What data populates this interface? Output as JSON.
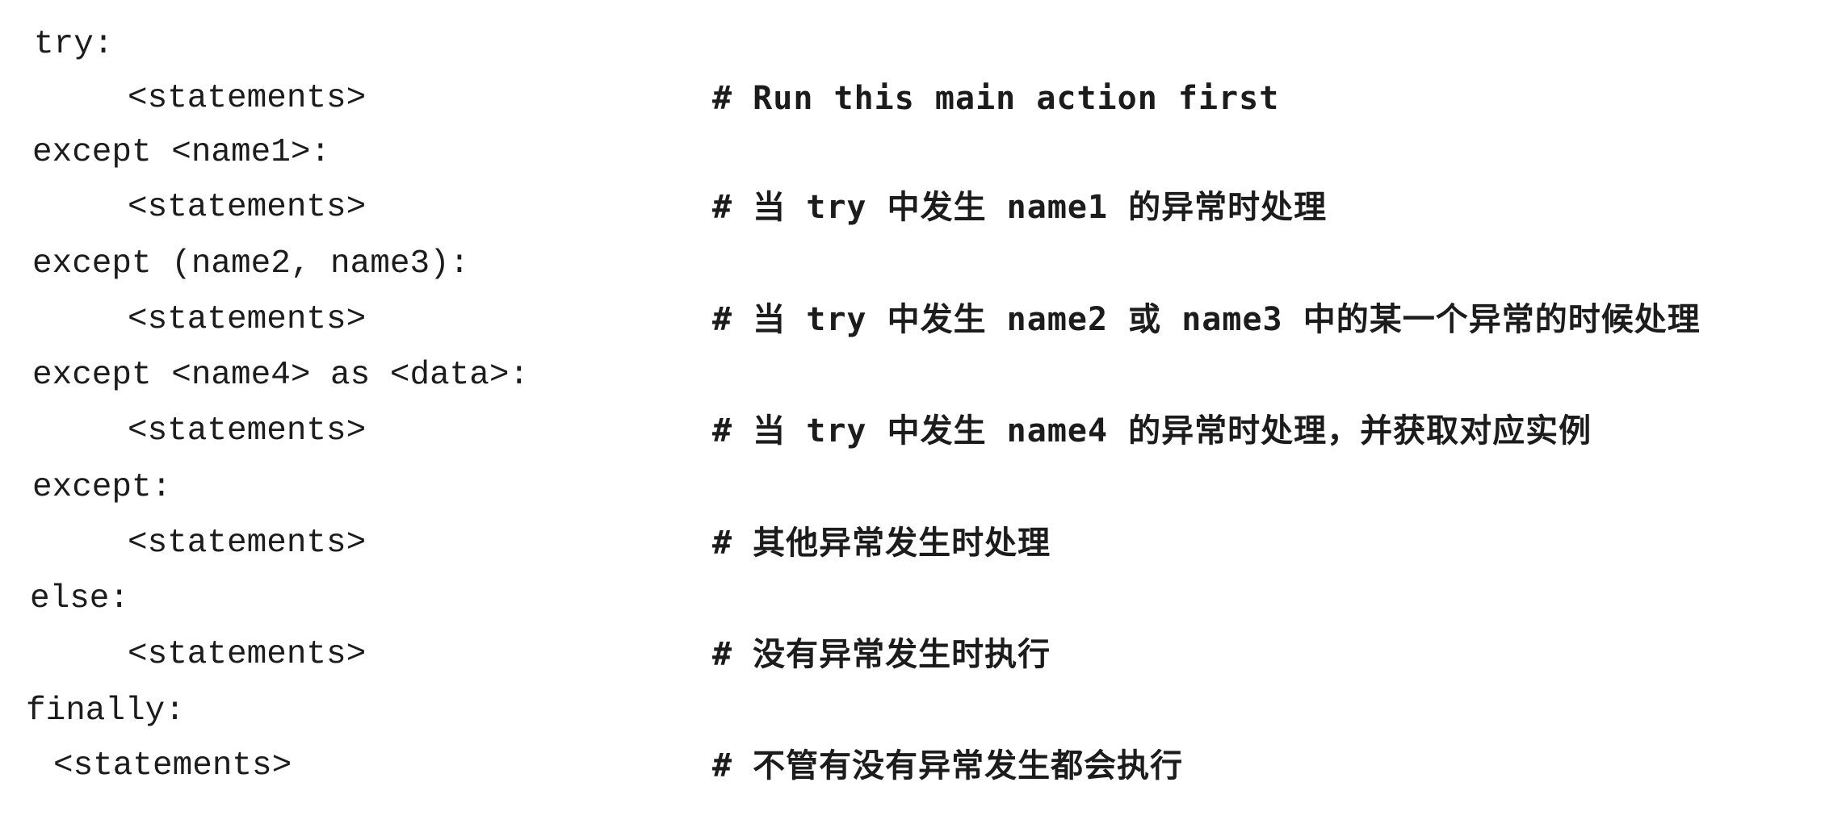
{
  "code_lines": [
    {
      "code": "try:",
      "comment": ""
    },
    {
      "code": "<statements>",
      "comment": "# Run this main action first"
    },
    {
      "code": "except <name1>:",
      "comment": ""
    },
    {
      "code": "<statements>",
      "comment": "# 当 try 中发生 name1 的异常时处理"
    },
    {
      "code": "except (name2, name3):",
      "comment": ""
    },
    {
      "code": "<statements>",
      "comment": "# 当 try 中发生 name2 或 name3 中的某一个异常的时候处理"
    },
    {
      "code": "except <name4> as <data>:",
      "comment": ""
    },
    {
      "code": "<statements>",
      "comment": "# 当 try 中发生 name4 的异常时处理，并获取对应实例"
    },
    {
      "code": "except:",
      "comment": ""
    },
    {
      "code": "<statements>",
      "comment": "# 其他异常发生时处理"
    },
    {
      "code": "else:",
      "comment": ""
    },
    {
      "code": "<statements>",
      "comment": "# 没有异常发生时执行"
    },
    {
      "code": "finally:",
      "comment": ""
    },
    {
      "code": "<statements>",
      "comment": "# 不管有没有异常发生都会执行"
    }
  ]
}
